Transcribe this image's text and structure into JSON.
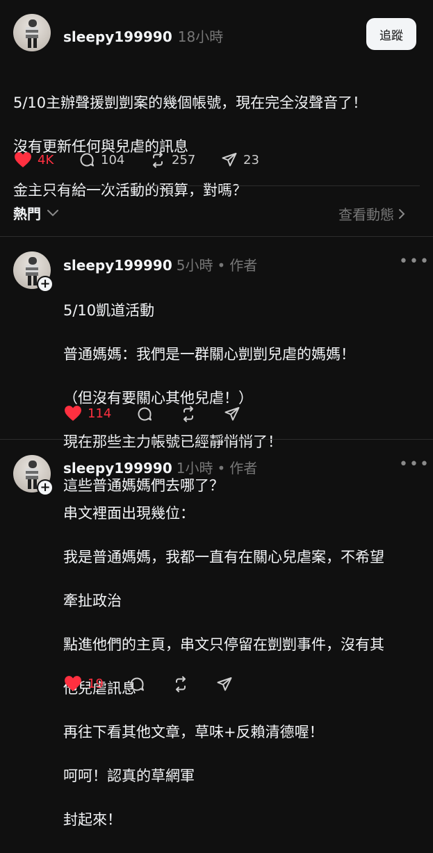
{
  "colors": {
    "background": "#101010",
    "text": "#f3f5f7",
    "muted": "#777777",
    "like": "#ff3040",
    "divider": "#2d2d2d"
  },
  "main_post": {
    "username": "sleepy199990",
    "time": "18小時",
    "follow_label": "追蹤",
    "lines": [
      "5/10主辦聲援剴剴案的幾個帳號，現在完全沒聲音了！",
      "沒有更新任何與兒虐的訊息",
      "金主只有給一次活動的預算，對嗎？"
    ],
    "likes": "4K",
    "replies": "104",
    "reposts": "257",
    "shares": "23"
  },
  "section": {
    "sort_label": "熱門",
    "view_activity_label": "查看動態"
  },
  "replies": [
    {
      "username": "sleepy199990",
      "time": "5小時",
      "role": "作者",
      "lines": [
        "5/10凱道活動",
        "普通媽媽：我們是一群關心剴剴兒虐的媽媽！",
        "（但沒有要關心其他兒虐！）",
        "現在那些主力帳號已經靜悄悄了！",
        "這些普通媽媽們去哪了？"
      ],
      "likes": "114"
    },
    {
      "username": "sleepy199990",
      "time": "1小時",
      "role": "作者",
      "lines": [
        "串文裡面出現幾位：",
        "我是普通媽媽，我都一直有在關心兒虐案，不希望",
        "牽扯政治",
        "點進他們的主頁，串文只停留在剴剴事件，沒有其",
        "他兒虐訊息",
        "再往下看其他文章，草味+反賴清德喔！",
        "呵呵！認真的草網軍",
        "封起來！"
      ],
      "likes": "19"
    }
  ],
  "icons": {
    "like": "heart-icon",
    "reply": "comment-icon",
    "repost": "repost-icon",
    "share": "send-icon",
    "more": "more-icon",
    "plus": "plus-icon",
    "chevron_down": "chevron-down-icon",
    "chevron_right": "chevron-right-icon"
  },
  "more_glyph": "•••",
  "plus_glyph": "+",
  "dot_separator": "•"
}
